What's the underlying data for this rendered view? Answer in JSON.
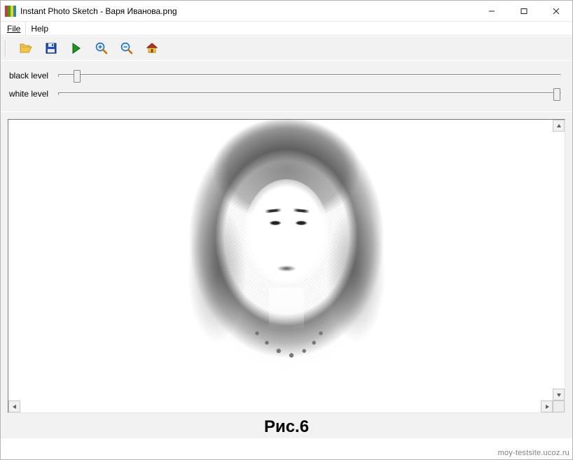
{
  "window": {
    "title": "Instant Photo Sketch - Варя Иванова.png"
  },
  "menu": {
    "file": "File",
    "help": "Help"
  },
  "toolbar": {
    "open": "open-icon",
    "save": "save-icon",
    "play": "play-icon",
    "zoom_in": "zoom-in-icon",
    "zoom_out": "zoom-out-icon",
    "home": "home-icon"
  },
  "sliders": {
    "black_label": "black level",
    "black_value": 3,
    "white_label": "white level",
    "white_value": 100
  },
  "caption": "Рис.6",
  "watermark": "moy-testsite.ucoz.ru"
}
